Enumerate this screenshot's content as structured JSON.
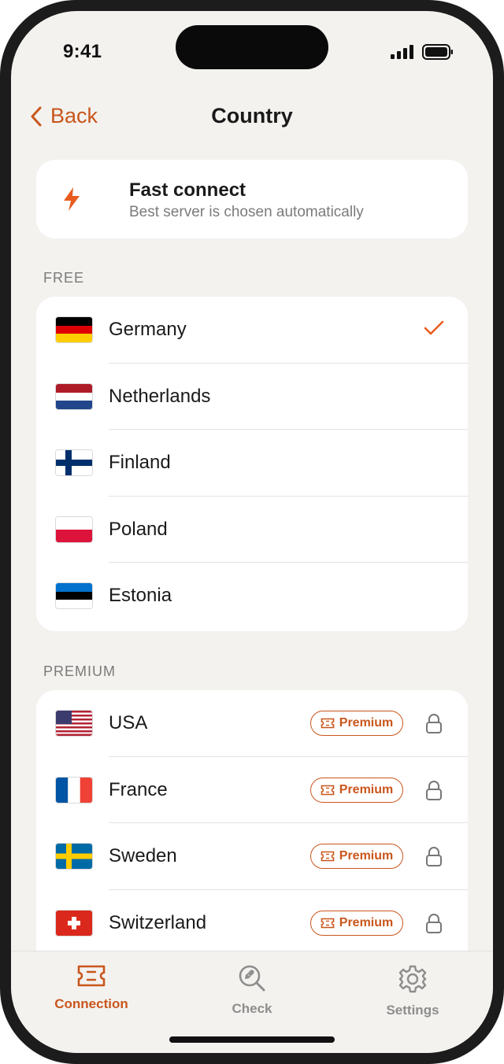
{
  "status": {
    "time": "9:41"
  },
  "nav": {
    "back_label": "Back",
    "title": "Country"
  },
  "fast_connect": {
    "title": "Fast connect",
    "subtitle": "Best server is chosen automatically",
    "icon": "lightning-bolt-icon"
  },
  "free_section": {
    "label": "FREE",
    "items": [
      {
        "name": "Germany",
        "selected": true
      },
      {
        "name": "Netherlands"
      },
      {
        "name": "Finland"
      },
      {
        "name": "Poland"
      },
      {
        "name": "Estonia"
      }
    ]
  },
  "premium_section": {
    "label": "PREMIUM",
    "badge_label": "Premium",
    "items": [
      {
        "name": "USA"
      },
      {
        "name": "France"
      },
      {
        "name": "Sweden"
      },
      {
        "name": "Switzerland"
      }
    ]
  },
  "tabs": [
    {
      "label": "Connection",
      "icon": "ticket-icon",
      "active": true
    },
    {
      "label": "Check",
      "icon": "magnifier-link-icon"
    },
    {
      "label": "Settings",
      "icon": "gear-icon"
    }
  ],
  "colors": {
    "accent": "#c9561c",
    "background": "#f3f2ef",
    "card": "#ffffff",
    "inactive_tab": "#8d8d8d"
  }
}
